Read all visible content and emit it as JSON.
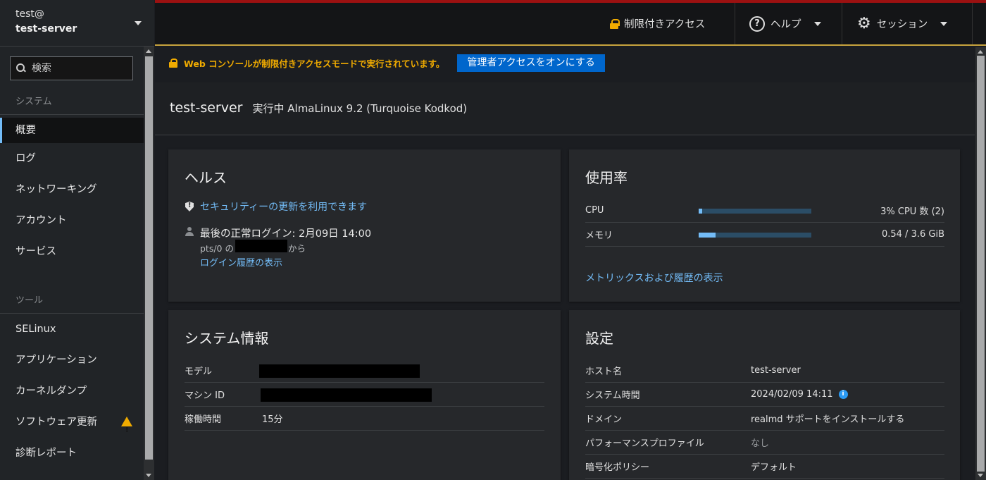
{
  "host_switcher": {
    "user": "test@",
    "host": "test-server"
  },
  "search": {
    "placeholder": "検索"
  },
  "sidebar": {
    "system_heading": "システム",
    "system_items": [
      {
        "label": "概要"
      },
      {
        "label": "ログ"
      },
      {
        "label": "ネットワーキング"
      },
      {
        "label": "アカウント"
      },
      {
        "label": "サービス"
      }
    ],
    "tools_heading": "ツール",
    "tool_items": [
      {
        "label": "SELinux"
      },
      {
        "label": "アプリケーション"
      },
      {
        "label": "カーネルダンプ"
      },
      {
        "label": "ソフトウェア更新",
        "icon": "warning-icon"
      },
      {
        "label": "診断レポート"
      }
    ]
  },
  "topbar": {
    "limited_access": "制限付きアクセス",
    "help": "ヘルプ",
    "session": "セッション"
  },
  "alert": {
    "text": "Web コンソールが制限付きアクセスモードで実行されています。",
    "button": "管理者アクセスをオンにする"
  },
  "page_header": {
    "host": "test-server",
    "os": "実行中 AlmaLinux 9.2 (Turquoise Kodkod)"
  },
  "health": {
    "title": "ヘルス",
    "security_link": "セキュリティーの更新を利用できます",
    "last_login": "最後の正常ログイン: 2月09日 14:00",
    "login_from_prefix": "pts/0 の",
    "login_from_suffix": "から",
    "history_link": "ログイン履歴の表示"
  },
  "usage": {
    "title": "使用率",
    "rows": [
      {
        "label": "CPU",
        "value": "3% CPU 数 (2)",
        "fraction": 0.03
      },
      {
        "label": "メモリ",
        "value": "0.54 / 3.6 GiB",
        "fraction": 0.15
      }
    ],
    "metrics_link": "メトリックスおよび履歴の表示"
  },
  "sysinfo": {
    "title": "システム情報",
    "rows": [
      {
        "label": "モデル",
        "value": ""
      },
      {
        "label": "マシン ID",
        "value": ""
      },
      {
        "label": "稼働時間",
        "value": "15分"
      }
    ]
  },
  "config": {
    "title": "設定",
    "rows": [
      {
        "label": "ホスト名",
        "value": "test-server"
      },
      {
        "label": "システム時間",
        "value": "2024/02/09 14:11"
      },
      {
        "label": "ドメイン",
        "value": "realmd サポートをインストールする"
      },
      {
        "label": "パフォーマンスプロファイル",
        "value": "なし"
      },
      {
        "label": "暗号化ポリシー",
        "value": "デフォルト"
      }
    ]
  },
  "colors": {
    "accent": "#73bcf7",
    "warning": "#f0ab00",
    "primary_button": "#0066cc"
  }
}
